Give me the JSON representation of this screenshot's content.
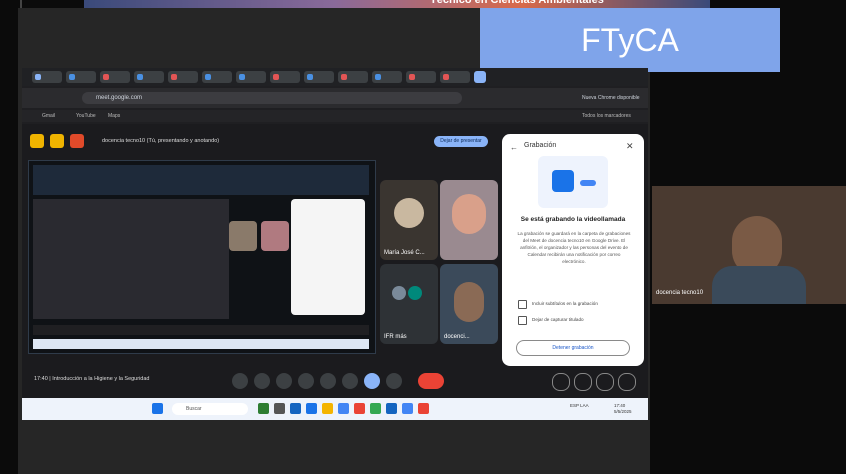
{
  "banner": {
    "text": "Técnico en Ciencias Ambientales"
  },
  "badge": {
    "label": "FTyCA"
  },
  "browser": {
    "url": "meet.google.com",
    "profile": "Nueva Chrome disponible",
    "bookmarks": [
      "Gmail",
      "YouTube",
      "Maps"
    ],
    "bookmarks_right": "Todos los marcadores"
  },
  "meet": {
    "title": "docencia tecno10 (Tú, presentando y anotando)",
    "stop_label": "Dejar de presentar",
    "tiles": [
      {
        "name": "María José C..."
      },
      {
        "name": "IFR más"
      },
      {
        "name": "docenci..."
      }
    ]
  },
  "recording": {
    "title": "Grabación",
    "heading": "Se está grabando la videollamada",
    "body": "La grabación se guardará en la carpeta de grabaciones del Meet de docencia tecno10 en Google Drive. El anfitrión, el organizador y las personas del evento de Calendar recibirán una notificación por correo electrónico.",
    "checks": [
      "Incluir subtítulos en la grabación",
      "Dejar de capturar titulado"
    ],
    "stop_label": "Detener grabación"
  },
  "meeting": {
    "label": "17:40 | Introducción a la Higiene y la Seguridad"
  },
  "taskbar": {
    "search": "Buscar",
    "lang": "ESP LAA",
    "time": "17:40",
    "date": "5/5/2025"
  },
  "cam": {
    "name": "docencia tecno10"
  }
}
